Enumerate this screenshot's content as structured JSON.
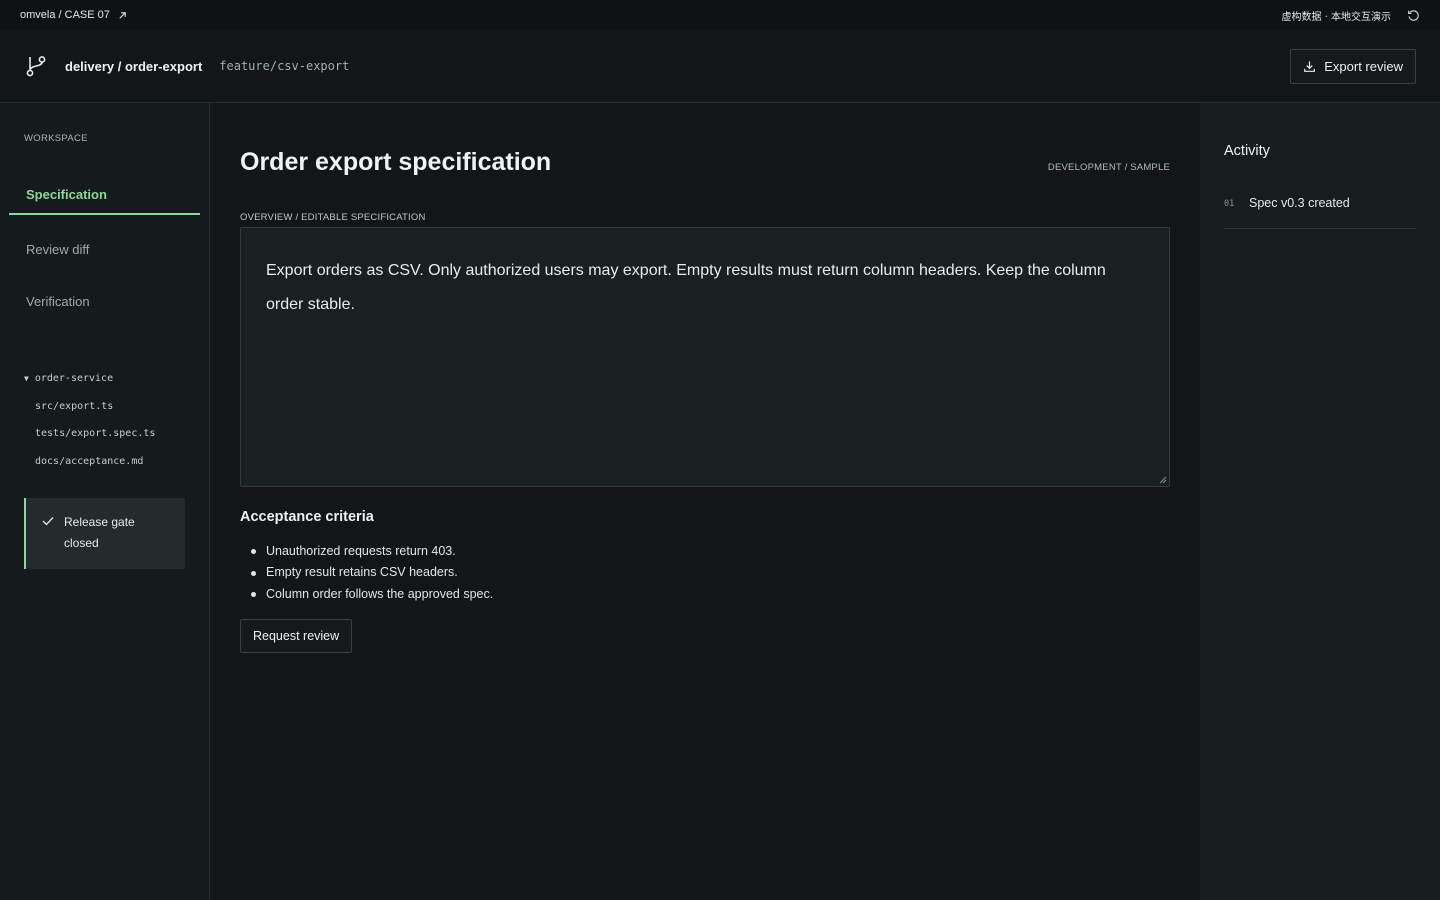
{
  "topbar": {
    "crumb": "omvela / CASE 07",
    "notice": "虚构数据 · 本地交互演示"
  },
  "header": {
    "repo": "delivery / order-export",
    "branch": "feature/csv-export",
    "export_label": "Export review"
  },
  "sidebar": {
    "workspace_label": "WORKSPACE",
    "nav": [
      {
        "label": "Specification",
        "active": true
      },
      {
        "label": "Review diff",
        "active": false
      },
      {
        "label": "Verification",
        "active": false
      }
    ],
    "tree": {
      "root": "order-service",
      "files": [
        "src/export.ts",
        "tests/export.spec.ts",
        "docs/acceptance.md"
      ]
    },
    "gate": "Release gate closed"
  },
  "main": {
    "title": "Order export specification",
    "env": "DEVELOPMENT / SAMPLE",
    "section_label": "OVERVIEW / EDITABLE SPECIFICATION",
    "spec_text": "Export orders as CSV. Only authorized users may export. Empty results must return column headers. Keep the column order stable.",
    "criteria_title": "Acceptance criteria",
    "criteria": [
      "Unauthorized requests return 403.",
      "Empty result retains CSV headers.",
      "Column order follows the approved spec."
    ],
    "request_label": "Request review"
  },
  "activity": {
    "title": "Activity",
    "items": [
      {
        "num": "01",
        "text": "Spec v0.3 created"
      }
    ]
  },
  "colors": {
    "accent": "#8fd69a",
    "background": "#121618"
  }
}
